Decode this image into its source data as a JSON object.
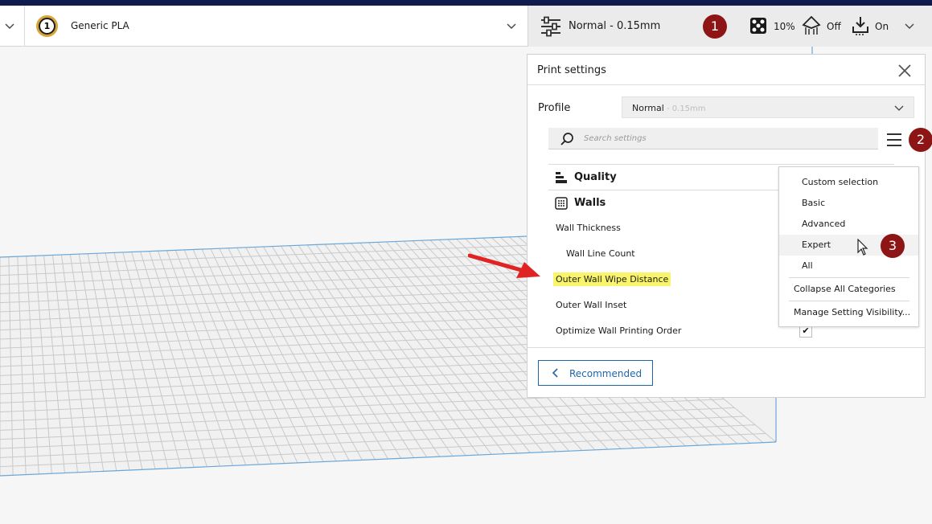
{
  "toolbar": {
    "extruder_number": "1",
    "material_name": "Generic PLA",
    "colors": {
      "extruder_ring": "#d9a53a",
      "header_bar": "#0f1b4d"
    },
    "print_setup": {
      "profile_label": "Normal - 0.15mm",
      "infill_value": "10%",
      "support_value": "Off",
      "adhesion_value": "On",
      "icons": [
        "sliders-icon",
        "infill-icon",
        "support-icon",
        "adhesion-icon",
        "chevron-down-icon"
      ]
    }
  },
  "badges": {
    "one": "1",
    "two": "2",
    "three": "3",
    "color": "#8e1515"
  },
  "panel": {
    "title": "Print settings",
    "profile_label": "Profile",
    "profile_name": "Normal",
    "profile_layer": " - 0.15mm",
    "search_placeholder": "Search settings",
    "categories": [
      {
        "label": "Quality",
        "icon": "quality-icon"
      },
      {
        "label": "Walls",
        "icon": "walls-icon"
      }
    ],
    "settings": [
      {
        "label": "Wall Thickness"
      },
      {
        "label": "Wall Line Count"
      },
      {
        "label": "Outer Wall Wipe Distance",
        "highlight": true
      },
      {
        "label": "Outer Wall Inset"
      },
      {
        "label": "Optimize Wall Printing Order",
        "checked": "✔"
      }
    ],
    "recommended_label": "Recommended"
  },
  "visibility_menu": {
    "presets": [
      "Custom selection",
      "Basic",
      "Advanced",
      "Expert",
      "All"
    ],
    "actions": [
      "Collapse All Categories",
      "Manage Setting Visibility..."
    ]
  }
}
